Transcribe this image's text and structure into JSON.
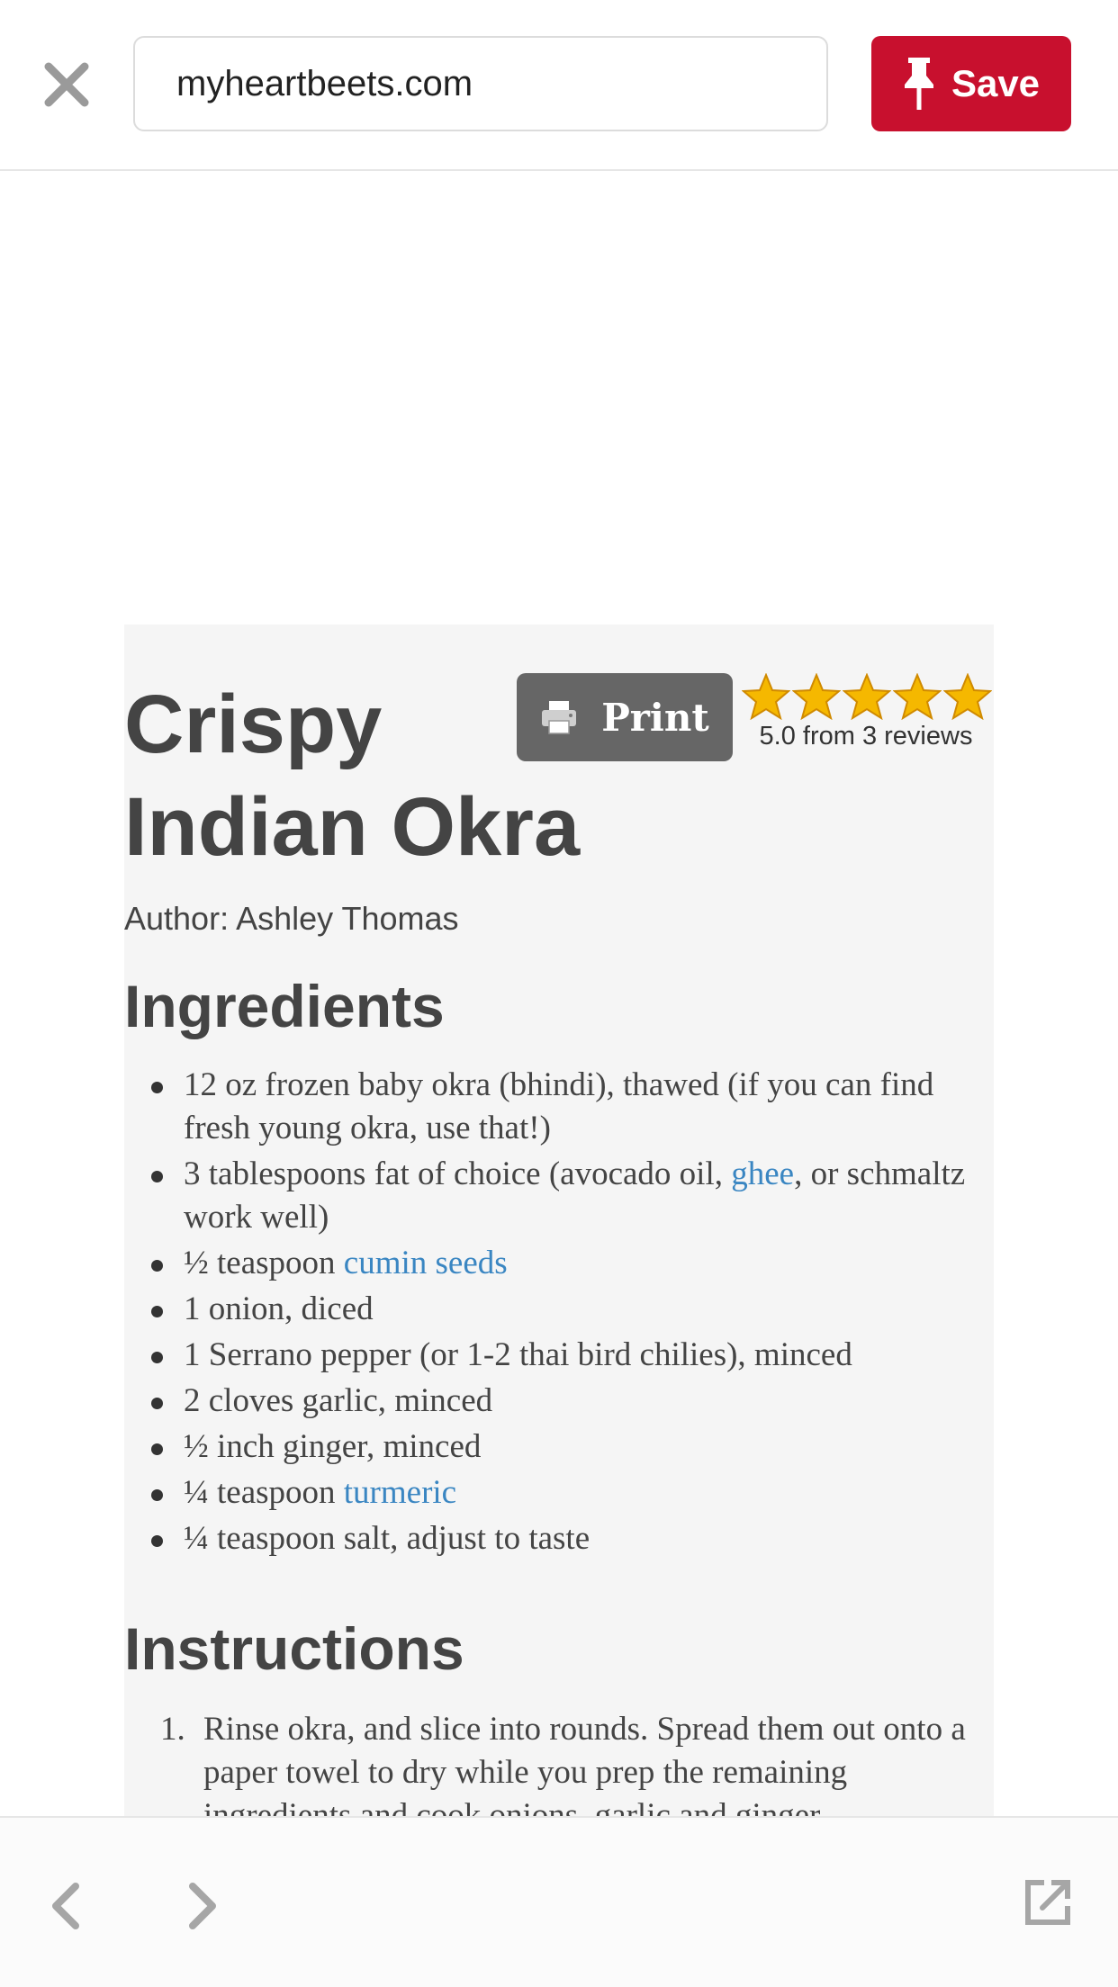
{
  "topbar": {
    "url": "myheartbeets.com",
    "save_label": "Save"
  },
  "recipe": {
    "title": "Crispy Indian Okra",
    "print_label": "Print",
    "rating": 5.0,
    "rating_text": "5.0 from 3 reviews",
    "author": "Author: Ashley Thomas",
    "ingredients_heading": "Ingredients",
    "ingredients": [
      {
        "pre": "12 oz frozen baby okra (bhindi), thawed (if you can find fresh young okra, use that!)",
        "link": "",
        "post": ""
      },
      {
        "pre": "3 tablespoons fat of choice (avocado oil, ",
        "link": "ghee",
        "post": ", or schmaltz work well)"
      },
      {
        "pre": "½ teaspoon ",
        "link": "cumin seeds",
        "post": ""
      },
      {
        "pre": "1 onion, diced",
        "link": "",
        "post": ""
      },
      {
        "pre": "1 Serrano pepper (or 1-2 thai bird chilies), minced",
        "link": "",
        "post": ""
      },
      {
        "pre": "2 cloves garlic, minced",
        "link": "",
        "post": ""
      },
      {
        "pre": "½ inch ginger, minced",
        "link": "",
        "post": ""
      },
      {
        "pre": "¼ teaspoon ",
        "link": "turmeric",
        "post": ""
      },
      {
        "pre": "¼ teaspoon salt, adjust to taste",
        "link": "",
        "post": ""
      }
    ],
    "instructions_heading": "Instructions",
    "instructions": [
      {
        "num": "1.",
        "text": "Rinse okra, and slice into rounds. Spread them out onto a paper towel to dry while you prep the remaining ingredients and cook onions, garlic and ginger."
      }
    ]
  },
  "icons": {
    "close": "close-icon",
    "pin": "pin-icon",
    "printer": "printer-icon",
    "star": "star-icon",
    "back": "chevron-left-icon",
    "forward": "chevron-right-icon",
    "external": "open-external-icon"
  },
  "colors": {
    "save": "#c8102e",
    "link": "#3a86c2",
    "star": "#f5b800",
    "print_button": "#666666"
  }
}
